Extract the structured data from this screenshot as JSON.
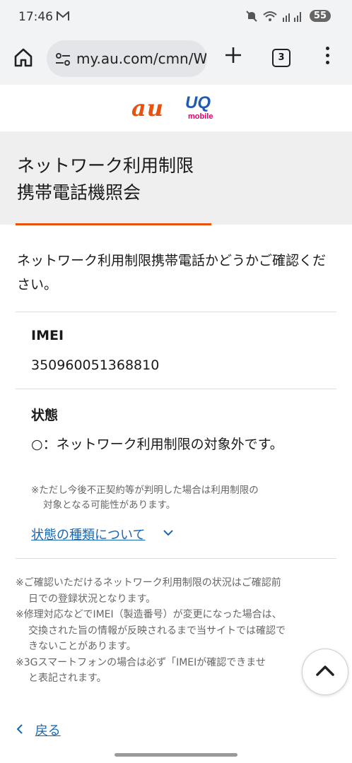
{
  "status_bar": {
    "time": "17:46",
    "battery": "55"
  },
  "browser": {
    "url": "my.au.com/cmn/W",
    "tab_count": "3"
  },
  "logos": {
    "au": "au",
    "uq": "UQ",
    "uq_sub": "mobile"
  },
  "page": {
    "title_line1": "ネットワーク利用制限",
    "title_line2": "携帯電話機照会",
    "intro": "ネットワーク利用制限携帯電話かどうかご確認ください。",
    "imei_label": "IMEI",
    "imei_value": "350960051368810",
    "status_label": "状態",
    "status_value": "○：ネットワーク利用制限の対象外です。",
    "status_note_line1": "※ただし今後不正契約等が判明した場合は利用制限の",
    "status_note_line2": "対象となる可能性があります。",
    "status_types_link": "状態の種類について",
    "footnote1_line1": "※ご確認いただけるネットワーク利用制限の状況はご確認前",
    "footnote1_line2": "日での登録状況となります。",
    "footnote2_line1": "※修理対応などでIMEI（製造番号）が変更になった場合は、",
    "footnote2_line2": "交換された旨の情報が反映されるまで当サイトでは確認で",
    "footnote2_line3": "きないことがあります。",
    "footnote3_line1": "※3Gスマートフォンの場合は必ず「IMEIが確認できませ",
    "footnote3_line2": "と表記されます。",
    "back_link": "戻る"
  },
  "colors": {
    "accent": "#e8520c",
    "link": "#1967b3",
    "title_bg": "#efefef",
    "browser_chrome": "#f1f3f4"
  },
  "icons": [
    "mail-icon",
    "mute-icon",
    "wifi-icon",
    "signal-icon",
    "home-icon",
    "site-settings-icon",
    "new-tab-icon",
    "tab-switcher-icon",
    "more-menu-icon",
    "chevron-down-icon",
    "chevron-up-icon",
    "chevron-left-icon"
  ]
}
